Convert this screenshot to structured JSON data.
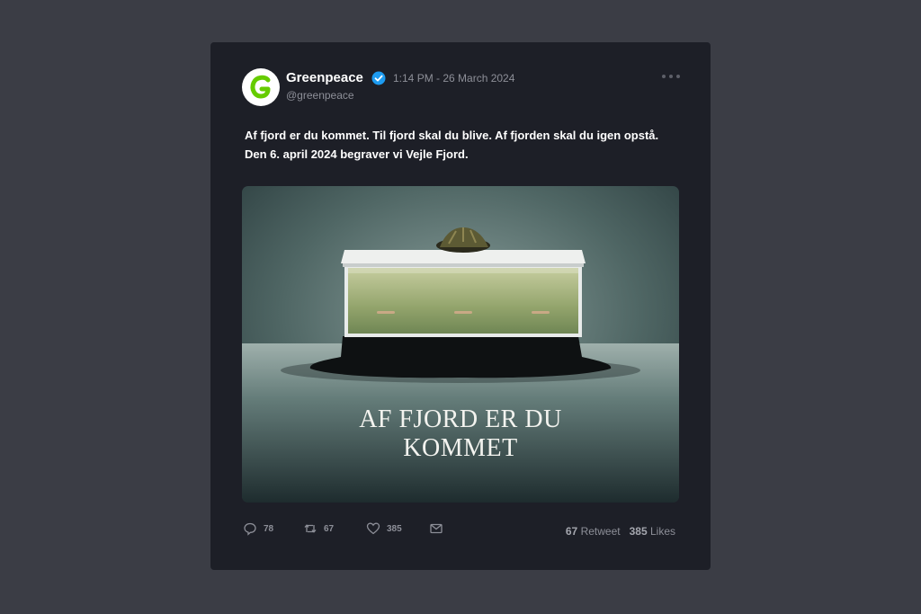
{
  "tweet": {
    "author_name": "Greenpeace",
    "handle": "@greenpeace",
    "timestamp": "1:14 PM - 26 March 2024",
    "text_line1": "Af fjord er du kommet. Til fjord skal du blive. Af fjorden skal du igen opstå.",
    "text_line2": "Den 6. april 2024 begraver vi Vejle Fjord.",
    "image_caption_line1": "AF FJORD ER DU",
    "image_caption_line2": "KOMMET",
    "avatar_letter": "G",
    "verified": true
  },
  "actions": {
    "replies": "78",
    "retweets": "67",
    "likes": "385"
  },
  "stats": {
    "retweet_count": "67",
    "retweet_label": "Retweet",
    "likes_count": "385",
    "likes_label": "Likes"
  },
  "icons": [
    "more-dots-icon",
    "verified-badge-icon",
    "reply-icon",
    "retweet-icon",
    "heart-icon",
    "mail-icon"
  ],
  "colors": {
    "page_bg": "#3b3d45",
    "card_bg": "#1d1f27",
    "verified_blue": "#1d9bf0",
    "greenpeace_green": "#66cc00",
    "muted_text": "#8d8f98"
  }
}
